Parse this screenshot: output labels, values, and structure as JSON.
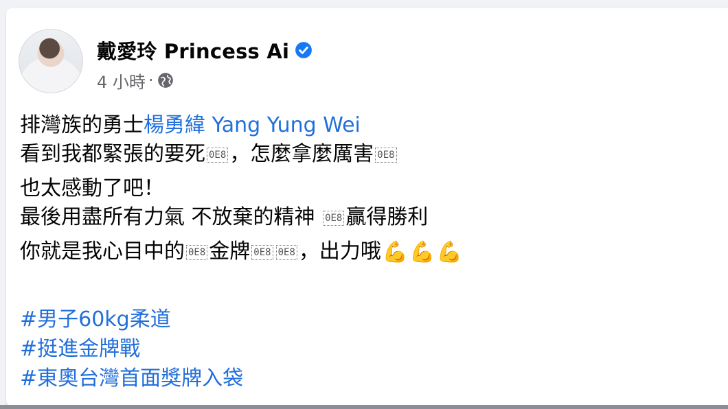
{
  "post": {
    "author": "戴愛玲 Princess Ai",
    "time": "4 小時",
    "meta_separator": "·",
    "paragraphs": [
      {
        "line1_prefix": "排灣族的勇士",
        "line1_link": "楊勇緯 Yang Yung Wei",
        "line2_part1": "看到我都緊張的要死",
        "line2_part2": "，怎麼拿麼厲害"
      },
      {
        "line1": "也太感動了吧！",
        "line2_part1": "最後用盡所有力氣 不放棄的精神 ",
        "line2_part2": "贏得勝利"
      },
      {
        "line1_part1": "你就是我心目中的",
        "line1_part2": "金牌",
        "line1_part3": "，出力哦"
      }
    ],
    "emoji_placeholder": "0E8",
    "hashtags": [
      "#男子60kg柔道",
      "#挺進金牌戰",
      "#東奧台灣首面獎牌入袋"
    ]
  },
  "colors": {
    "link": "#216fdb",
    "text": "#050505",
    "meta": "#65676b",
    "verified": "#1877f2"
  },
  "icons": {
    "verified": "verified-badge-icon",
    "audience": "globe-icon",
    "emoji": "flexed-biceps-emoji"
  }
}
